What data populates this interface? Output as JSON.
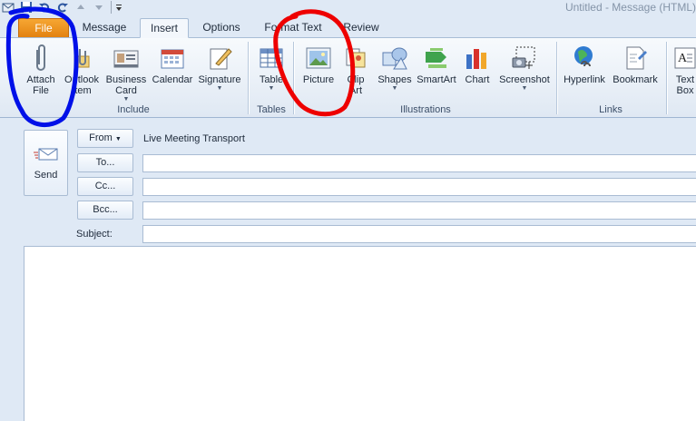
{
  "window": {
    "title": "Untitled  -  Message (HTML)"
  },
  "qat": {
    "icons": [
      "outlook-icon",
      "save-icon",
      "undo-icon",
      "redo-icon",
      "up-icon",
      "down-icon",
      "customize-icon"
    ]
  },
  "tabs": [
    {
      "label": "File"
    },
    {
      "label": "Message"
    },
    {
      "label": "Insert"
    },
    {
      "label": "Options"
    },
    {
      "label": "Format Text"
    },
    {
      "label": "Review"
    }
  ],
  "ribbon": {
    "include": {
      "label": "Include",
      "attach_file": "Attach\nFile",
      "outlook_item": "Outlook\nItem",
      "business_card": "Business\nCard",
      "calendar": "Calendar",
      "signature": "Signature"
    },
    "tables": {
      "label": "Tables",
      "table": "Table"
    },
    "illustrations": {
      "label": "Illustrations",
      "picture": "Picture",
      "clip_art": "Clip\nArt",
      "shapes": "Shapes",
      "smartart": "SmartArt",
      "chart": "Chart",
      "screenshot": "Screenshot"
    },
    "links": {
      "label": "Links",
      "hyperlink": "Hyperlink",
      "bookmark": "Bookmark"
    },
    "text": {
      "text_box": "Text\nBox"
    }
  },
  "header": {
    "send": "Send",
    "from_btn": "From",
    "from_value": "Live Meeting Transport",
    "to_btn": "To...",
    "cc_btn": "Cc...",
    "bcc_btn": "Bcc...",
    "subject_label": "Subject:",
    "to_value": "",
    "cc_value": "",
    "bcc_value": "",
    "subject_value": ""
  },
  "annotations": {
    "blue": "#0010e8",
    "red": "#ee0000"
  }
}
